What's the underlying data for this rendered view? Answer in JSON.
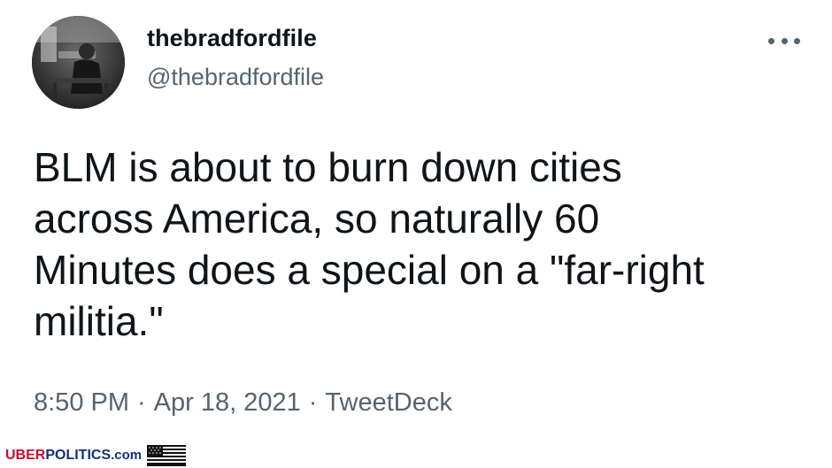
{
  "tweet": {
    "display_name": "thebradfordfile",
    "handle": "@thebradfordfile",
    "text_lines": [
      "BLM is about to burn down cities",
      "across America, so naturally 60",
      "Minutes does a special on a \"far-right",
      "militia.\""
    ],
    "time": "8:50 PM",
    "date": "Apr 18, 2021",
    "source": "TweetDeck",
    "separator": "·"
  },
  "icons": {
    "more": "more-options-icon",
    "avatar": "profile-photo",
    "flag": "us-flag-icon"
  },
  "watermark": {
    "uber": "UBER",
    "politics": "POLITICS",
    "com": ".com"
  },
  "colors": {
    "text_primary": "#0f1419",
    "text_secondary": "#536471",
    "brand_red": "#c8102e",
    "brand_blue": "#12317a"
  }
}
